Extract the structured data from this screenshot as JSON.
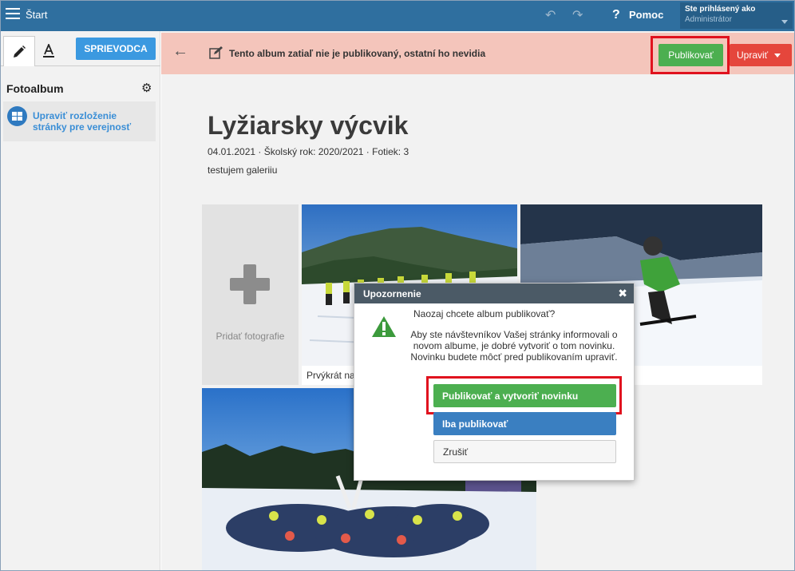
{
  "topbar": {
    "start_label": "Štart",
    "help_label": "Pomoc",
    "user_caption": "Ste prihlásený ako",
    "user_name": "Administrátor"
  },
  "sidebar": {
    "guide_button": "SPRIEVODCA",
    "section_title": "Fotoalbum",
    "item_label": "Upraviť rozloženie stránky pre verejnosť"
  },
  "notice": {
    "message": "Tento album zatiaľ nie je publikovaný, ostatní ho nevidia",
    "publish_button": "Publikovať",
    "edit_button": "Upraviť"
  },
  "album": {
    "title": "Lyžiarsky výcvik",
    "meta": "04.01.2021 · Školský rok: 2020/2021 · Fotiek: 3",
    "description": "testujem galeriiu",
    "add_photos": "Pridať fotografie",
    "photo1_caption": "Prvýkrát na"
  },
  "modal": {
    "title": "Upozornenie",
    "question": "Naozaj chcete album publikovať?",
    "info": "Aby ste návštevníkov Vašej stránky informovali o novom albume, je dobré vytvoriť o tom novinku. Novinku budete môcť pred publikovaním upraviť.",
    "btn_publish_news": "Publikovať a vytvoriť novinku",
    "btn_publish_only": "Iba publikovať",
    "btn_cancel": "Zrušiť"
  },
  "colors": {
    "topbar": "#2f6f9f",
    "notice_bg": "#f4c5bb",
    "publish_green": "#4caf50",
    "edit_red": "#e5463c",
    "highlight": "#e0121e"
  }
}
